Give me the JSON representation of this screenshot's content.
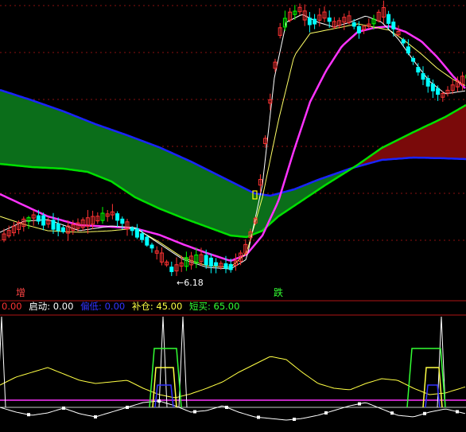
{
  "chart_data": [
    {
      "type": "candlestick",
      "panel": "main",
      "annotations": {
        "low_price_label": "6.18",
        "marker_left": "增",
        "marker_right": "跌"
      },
      "colors": {
        "up": "#ff3333",
        "down": "#00ffff",
        "special": "#00ff00",
        "band_fill_bearish": "#0b6e1a",
        "band_fill_bullish": "#7a0a0a",
        "band_upper": "#1a24ff",
        "band_lower": "#00e000",
        "ma_magenta": "#ff33ff",
        "ma_yellow": "#ffff66",
        "ma_white": "#ffffff"
      }
    },
    {
      "type": "line",
      "panel": "indicator",
      "labels": [
        {
          "text": "0.00",
          "color": "#ff3333"
        },
        {
          "text": "启动: 0.00",
          "color": "#ffffff"
        },
        {
          "text": "偏低: 0.00",
          "color": "#3333ff"
        },
        {
          "text": "补仓: 45.00",
          "color": "#ffff44"
        },
        {
          "text": "短买: 65.00",
          "color": "#33ff33"
        }
      ],
      "series_colors": [
        "#ffff44",
        "#ffffff",
        "#ff33ff",
        "#33ff33",
        "#3333ff",
        "#c8c8c8"
      ]
    }
  ]
}
